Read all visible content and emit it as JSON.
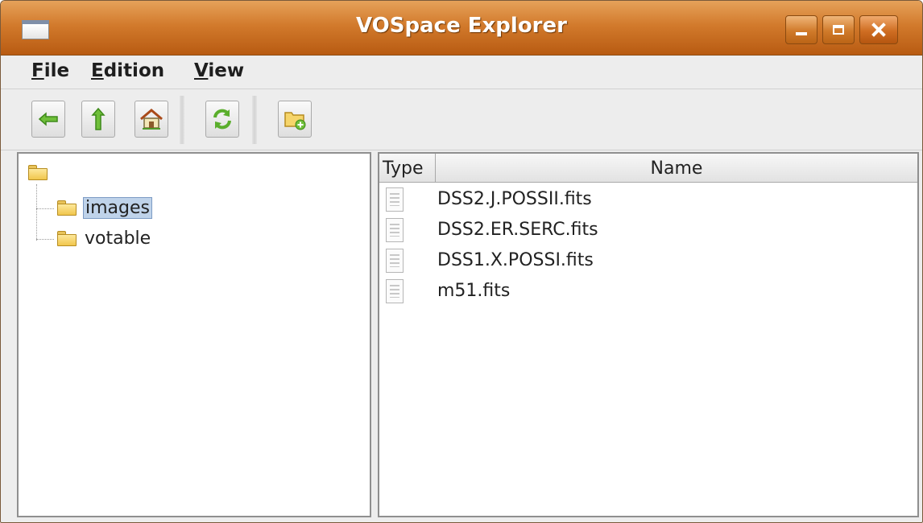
{
  "window": {
    "title": "VOSpace Explorer",
    "icons": [
      "window-icon",
      "minimize-icon",
      "maximize-icon",
      "close-icon"
    ]
  },
  "menu": {
    "items": [
      {
        "label": "File"
      },
      {
        "label": "Edition"
      },
      {
        "label": "View"
      }
    ]
  },
  "toolbar": {
    "buttons": [
      {
        "icon": "back-arrow-icon"
      },
      {
        "icon": "up-arrow-icon"
      },
      {
        "icon": "home-icon"
      },
      {
        "icon": "refresh-icon"
      },
      {
        "icon": "new-folder-icon"
      }
    ]
  },
  "tree": {
    "root_icon": "folder-icon",
    "nodes": [
      {
        "label": "images",
        "selected": true
      },
      {
        "label": "votable",
        "selected": false
      }
    ]
  },
  "table": {
    "columns": [
      "Type",
      "Name"
    ],
    "rows": [
      {
        "type_icon": "document-icon",
        "name": "DSS2.J.POSSII.fits"
      },
      {
        "type_icon": "document-icon",
        "name": "DSS2.ER.SERC.fits"
      },
      {
        "type_icon": "document-icon",
        "name": "DSS1.X.POSSI.fits"
      },
      {
        "type_icon": "document-icon",
        "name": "m51.fits"
      }
    ]
  },
  "colors": {
    "titlebar": "#d27a2c",
    "selection": "#bfd3ea",
    "folder": "#f1c64d"
  }
}
